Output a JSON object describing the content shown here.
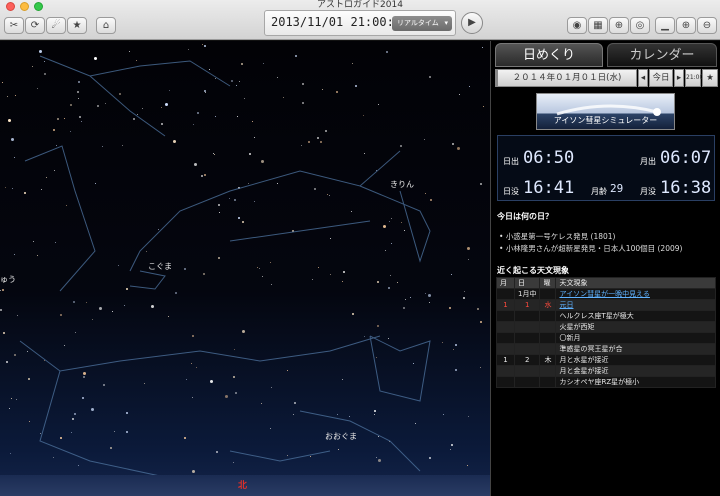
{
  "window": {
    "title": "アストロガイド2014"
  },
  "toolbar": {
    "datetime": "2013/11/01 21:00:00",
    "mode": "リアルタイム",
    "left_icons": [
      "scissors-icon",
      "rotate-icon",
      "comet-icon",
      "star-icon",
      "observatory-icon"
    ],
    "right_icons": [
      "eye-icon",
      "grid-icon",
      "target-icon",
      "eye-icon",
      "horizon-icon",
      "zoom-in-icon",
      "zoom-out-icon"
    ]
  },
  "sky": {
    "labels": {
      "kirin": "きりん",
      "koguma": "こぐま",
      "oguma": "おおぐま",
      "left_edge": "ゅう"
    },
    "direction": "北"
  },
  "panel": {
    "tab_daily": "日めくり",
    "tab_calendar": "カレンダー",
    "date": "２０１４年０１月０１日(水)",
    "today_btn": "今日",
    "time_btn": "21:00",
    "banner": "アイソン彗星シミュレーター",
    "sun_moon": {
      "sunrise_label": "日出",
      "sunrise": "06:50",
      "moonrise_label": "月出",
      "moonrise": "06:07",
      "sunset_label": "日没",
      "sunset": "16:41",
      "moonage_label": "月齢",
      "moonage": "29",
      "moonset_label": "月没",
      "moonset": "16:38"
    },
    "anniv_title": "今日は何の日？",
    "anniv": [
      "小惑星第一号ケレス発見 (1801)",
      "小林隆男さんが超新星発見・日本人100個目 (2009)"
    ],
    "events_title": "近く起こる天文現象",
    "events_headers": [
      "月",
      "日",
      "曜",
      "天文現象"
    ],
    "events": [
      {
        "m": "",
        "d": "1月中",
        "w": "",
        "text": "アイソン彗星が一晩中見える",
        "link": true
      },
      {
        "m": "1",
        "d": "1",
        "w": "水",
        "text": "元日",
        "link": true,
        "red": true
      },
      {
        "m": "",
        "d": "",
        "w": "",
        "text": "ヘルクレス座T星が極大"
      },
      {
        "m": "",
        "d": "",
        "w": "",
        "text": "火星が西矩"
      },
      {
        "m": "",
        "d": "",
        "w": "",
        "text": "〇新月"
      },
      {
        "m": "",
        "d": "",
        "w": "",
        "text": "準惑星の冥王星が合"
      },
      {
        "m": "1",
        "d": "2",
        "w": "木",
        "text": "月と水星が接近"
      },
      {
        "m": "",
        "d": "",
        "w": "",
        "text": "月と金星が接近"
      },
      {
        "m": "",
        "d": "",
        "w": "",
        "text": "カシオペヤ座RZ星が極小"
      }
    ]
  }
}
